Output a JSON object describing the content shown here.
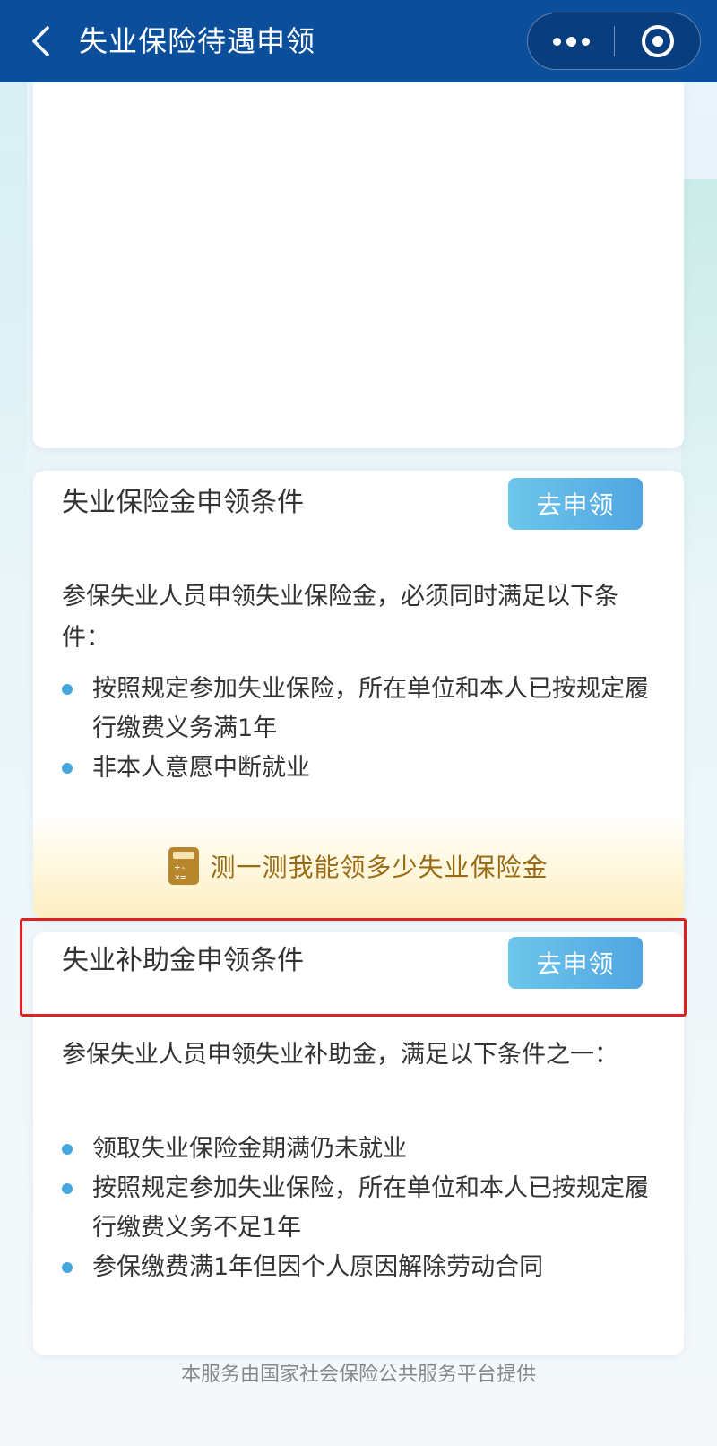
{
  "topbar": {
    "title": "失业保险待遇申领",
    "back_icon": "chevron-left-icon",
    "more_icon": "more-dots-icon",
    "close_icon": "close-target-icon",
    "bg_color": "#0b4f9c"
  },
  "insurance_card": {
    "title": "失业保险金申领条件",
    "apply_label": "去申领",
    "intro": "参保失业人员申领失业保险金，必须同时满足以下条件：",
    "conditions": [
      "按照规定参加失业保险，所在单位和本人已按规定履行缴费义务满1年",
      "非本人意愿中断就业"
    ],
    "calculator_link": "测一测我能领多少失业保险金",
    "calculator_icon": "calculator-icon"
  },
  "subsidy_card": {
    "title": "失业补助金申领条件",
    "apply_label": "去申领",
    "intro": "参保失业人员申领失业补助金，满足以下条件之一：",
    "conditions": [
      "领取失业保险金期满仍未就业",
      "按照规定参加失业保险，所在单位和本人已按规定履行缴费义务不足1年",
      "参保缴费满1年但因个人原因解除劳动合同"
    ]
  },
  "footer": {
    "text": "本服务由国家社会保险公共服务平台提供"
  },
  "colors": {
    "accent": "#4fa6e2",
    "highlight": "#e02020",
    "calculator_text": "#9a6a12"
  }
}
